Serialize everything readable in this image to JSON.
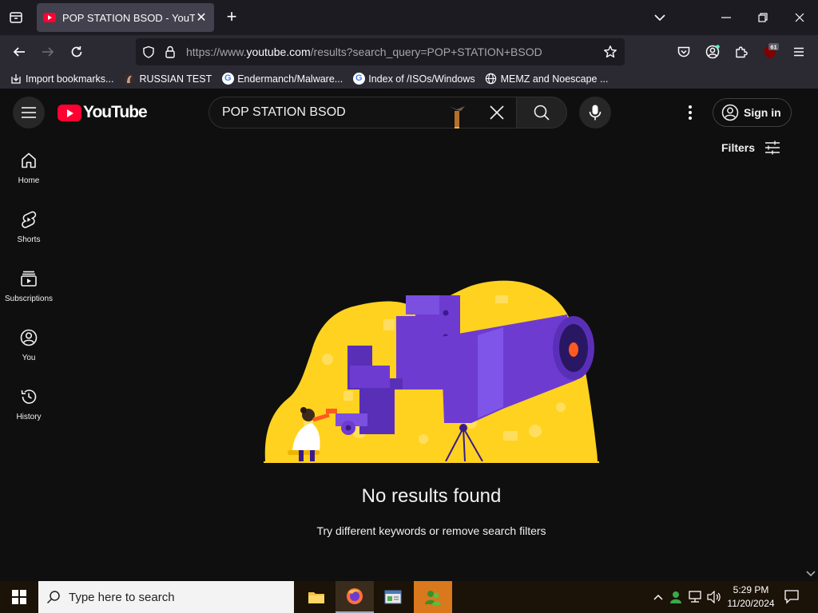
{
  "browser": {
    "tab_title": "POP STATION BSOD - YouTube",
    "url_prefix": "https://www.",
    "url_host": "youtube.com",
    "url_path": "/results?search_query=POP+STATION+BSOD",
    "badge_count": "61",
    "bookmarks": [
      {
        "label": "Import bookmarks...",
        "icon": "import-icon"
      },
      {
        "label": "RUSSIAN TEST",
        "icon": "custom-favicon"
      },
      {
        "label": "Endermanch/Malware...",
        "icon": "google-icon"
      },
      {
        "label": "Index of /ISOs/Windows",
        "icon": "google-icon"
      },
      {
        "label": "MEMZ and Noescape ...",
        "icon": "globe-icon"
      }
    ]
  },
  "youtube": {
    "logo_text": "YouTube",
    "search_query": "POP STATION BSOD",
    "sign_in": "Sign in",
    "filters": "Filters",
    "sidebar": [
      {
        "label": "Home",
        "icon": "home-icon"
      },
      {
        "label": "Shorts",
        "icon": "shorts-icon"
      },
      {
        "label": "Subscriptions",
        "icon": "subscriptions-icon"
      },
      {
        "label": "You",
        "icon": "you-icon"
      },
      {
        "label": "History",
        "icon": "history-icon"
      }
    ],
    "empty_title": "No results found",
    "empty_hint": "Try different keywords or remove search filters"
  },
  "taskbar": {
    "search_placeholder": "Type here to search",
    "time": "5:29 PM",
    "date": "11/20/2024"
  },
  "colors": {
    "yt_red": "#ff0033",
    "illus_yellow": "#ffd21f",
    "illus_purple": "#6e3bd1",
    "illus_orange": "#ff5a1f"
  }
}
